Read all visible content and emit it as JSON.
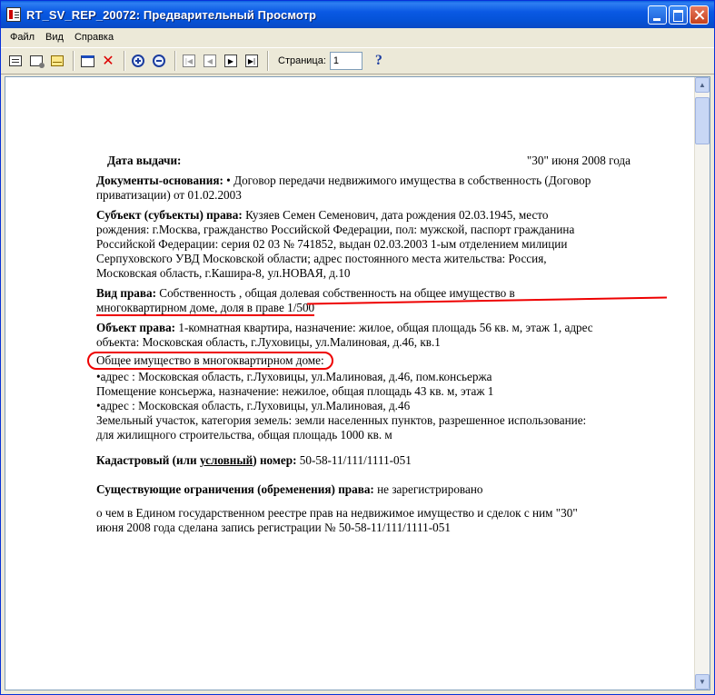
{
  "window": {
    "title": "RT_SV_REP_20072: Предварительный Просмотр"
  },
  "menu": [
    "Файл",
    "Вид",
    "Справка"
  ],
  "toolbar": {
    "page_label": "Страница:",
    "page_value": "1",
    "help_glyph": "?"
  },
  "document": {
    "issue_label": "Дата выдачи:",
    "issue_date": "\"30\" июня 2008 года",
    "docs_label": "Документы-основания:",
    "docs_text_1": " • Договор передачи недвижимого имущества в собственность (Договор",
    "docs_text_2": "приватизации) от 01.02.2003",
    "subject_label": "Субъект (субъекты) права:",
    "subject_text_1": "  Кузяев Семен Семенович, дата рождения 02.03.1945, место",
    "subject_text_2": "рождения: г.Москва, гражданство Российской Федерации, пол: мужской, паспорт гражданина",
    "subject_text_3": "Российской Федерации: серия 02 03 № 741852, выдан 02.03.2003 1-ым отделением милиции",
    "subject_text_4": "Серпуховского УВД Московской области; адрес постоянного места жительства: Россия,",
    "subject_text_5": "Московская область, г.Кашира-8, ул.НОВАЯ, д.10",
    "right_label": "Вид права:",
    "right_text_1": "  Собственность  , ",
    "right_text_1b": "общая долевая собственность на общее имущество в",
    "right_text_2": "многоквартирном доме, доля в праве 1/500",
    "object_label": "Объект права:",
    "object_text_1": " 1-комнатная квартира, назначение: жилое, общая площадь 56 кв. м, этаж 1, адрес",
    "object_text_2": "объекта: Московская область, г.Луховицы, ул.Малиновая, д.46, кв.1",
    "common_label": "Общее имущество в многоквартирном доме:",
    "common_line_1": "•адрес : Московская область, г.Луховицы, ул.Малиновая, д.46, пом.консьержа",
    "common_line_2": "Помещение консьержа, назначение: нежилое, общая площадь 43 кв. м, этаж 1",
    "common_line_3": "•адрес : Московская область, г.Луховицы, ул.Малиновая, д.46",
    "common_line_4": "Земельный участок, категория земель: земли населенных пунктов, разрешенное использование:",
    "common_line_5": "для жилищного строительства, общая площадь 1000 кв. м",
    "cadastral_label_1": "Кадастровый (или ",
    "cadastral_label_u": "условный",
    "cadastral_label_2": ") номер:",
    "cadastral_value": " 50-58-11/111/1111-051",
    "restr_label": "Существующие ограничения (обременения) права:",
    "restr_value": " не зарегистрировано",
    "final_1": "о чем в Едином государственном реестре прав на недвижимое имущество и сделок с ним  \"30\"",
    "final_2": "июня 2008 года сделана запись регистрации № 50-58-11/111/1111-051"
  }
}
